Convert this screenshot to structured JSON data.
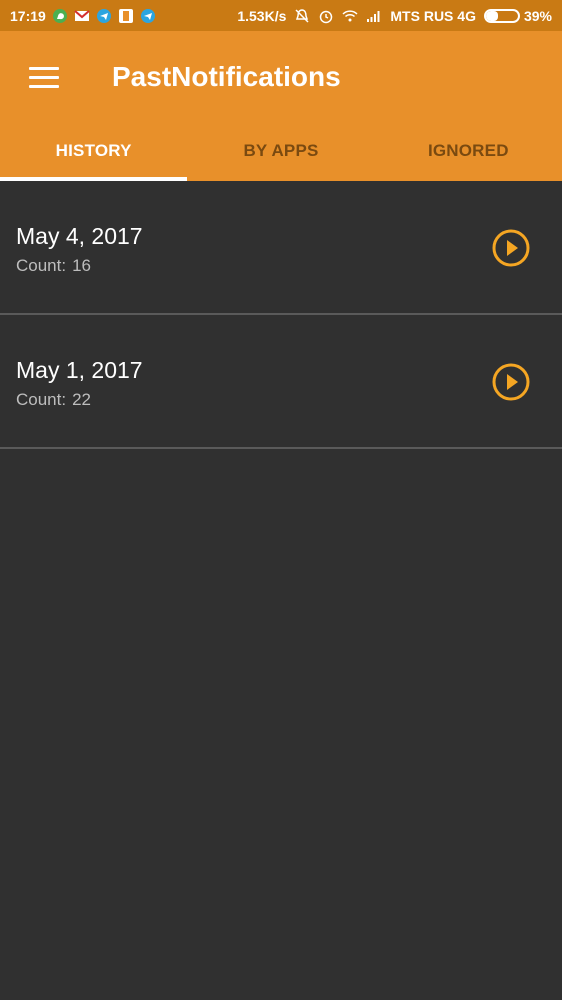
{
  "status_bar": {
    "time": "17:19",
    "notification_icons": [
      "whatsapp-icon",
      "gmail-icon",
      "telegram-icon",
      "app-icon",
      "telegram-icon"
    ],
    "speed": "1.53K/s",
    "carrier": "MTS RUS 4G",
    "battery_percent": "39%",
    "battery_level": 0.39
  },
  "app": {
    "title": "PastNotifications"
  },
  "tabs": [
    {
      "label": "HISTORY",
      "active": true
    },
    {
      "label": "BY APPS",
      "active": false
    },
    {
      "label": "IGNORED",
      "active": false
    }
  ],
  "history": {
    "count_label": "Count:",
    "items": [
      {
        "date": "May 4, 2017",
        "count": "16"
      },
      {
        "date": "May 1, 2017",
        "count": "22"
      }
    ]
  },
  "colors": {
    "primary": "#e8902a",
    "status_bar": "#c97a14",
    "background": "#303030",
    "accent": "#f5a623"
  }
}
